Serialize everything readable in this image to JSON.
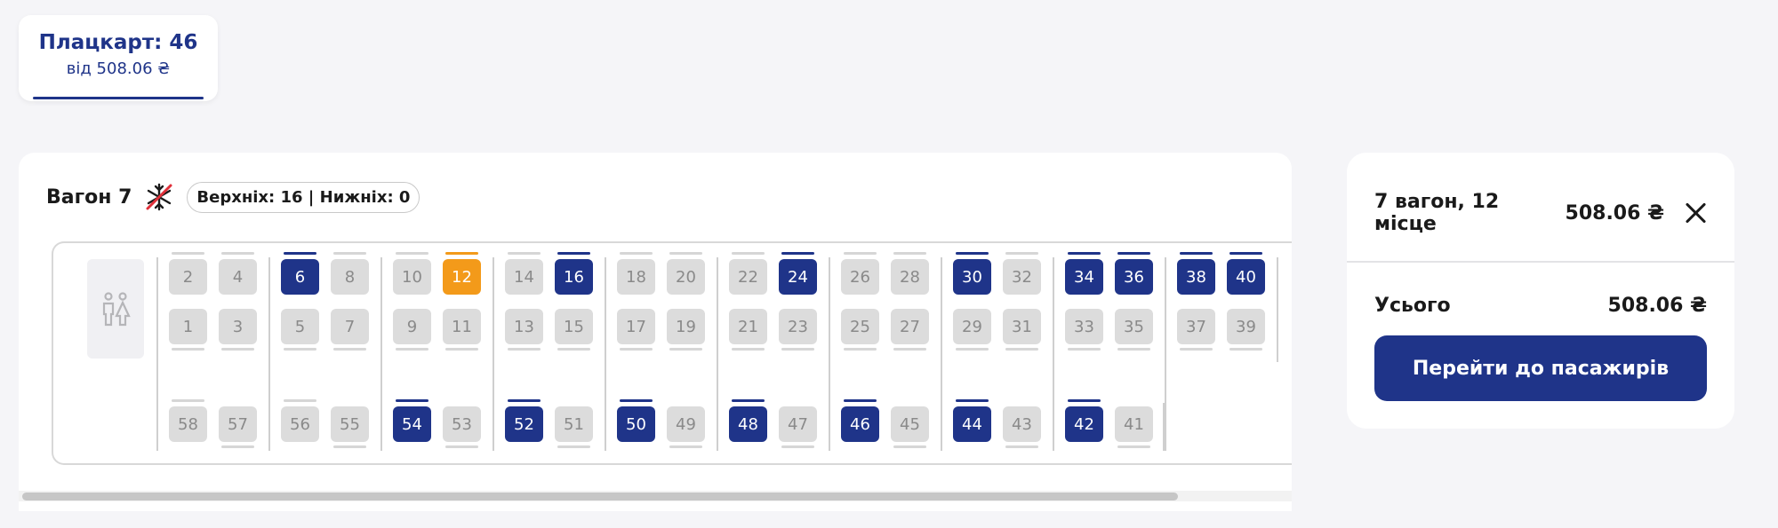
{
  "class_tab": {
    "title": "Плацкарт: 46",
    "price": "від 508.06 ₴"
  },
  "wagon": {
    "title": "Вагон 7",
    "icon": "no-ac-icon",
    "badge": "Верхніх: 16 | Нижніх: 0",
    "wc_icon": "toilet-icon",
    "compartments": [
      {
        "top": [
          [
            "2",
            "free"
          ],
          [
            "4",
            "free"
          ]
        ],
        "bottom": [
          [
            "1",
            "free"
          ],
          [
            "3",
            "free"
          ]
        ],
        "side": [
          [
            "58",
            "free"
          ],
          [
            "57",
            "free"
          ]
        ]
      },
      {
        "top": [
          [
            "6",
            "busy"
          ],
          [
            "8",
            "free"
          ]
        ],
        "bottom": [
          [
            "5",
            "free"
          ],
          [
            "7",
            "free"
          ]
        ],
        "side": [
          [
            "56",
            "free"
          ],
          [
            "55",
            "free"
          ]
        ]
      },
      {
        "top": [
          [
            "10",
            "free"
          ],
          [
            "12",
            "selected"
          ]
        ],
        "bottom": [
          [
            "9",
            "free"
          ],
          [
            "11",
            "free"
          ]
        ],
        "side": [
          [
            "54",
            "busy"
          ],
          [
            "53",
            "free"
          ]
        ]
      },
      {
        "top": [
          [
            "14",
            "free"
          ],
          [
            "16",
            "busy"
          ]
        ],
        "bottom": [
          [
            "13",
            "free"
          ],
          [
            "15",
            "free"
          ]
        ],
        "side": [
          [
            "52",
            "busy"
          ],
          [
            "51",
            "free"
          ]
        ]
      },
      {
        "top": [
          [
            "18",
            "free"
          ],
          [
            "20",
            "free"
          ]
        ],
        "bottom": [
          [
            "17",
            "free"
          ],
          [
            "19",
            "free"
          ]
        ],
        "side": [
          [
            "50",
            "busy"
          ],
          [
            "49",
            "free"
          ]
        ]
      },
      {
        "top": [
          [
            "22",
            "free"
          ],
          [
            "24",
            "busy"
          ]
        ],
        "bottom": [
          [
            "21",
            "free"
          ],
          [
            "23",
            "free"
          ]
        ],
        "side": [
          [
            "48",
            "busy"
          ],
          [
            "47",
            "free"
          ]
        ]
      },
      {
        "top": [
          [
            "26",
            "free"
          ],
          [
            "28",
            "free"
          ]
        ],
        "bottom": [
          [
            "25",
            "free"
          ],
          [
            "27",
            "free"
          ]
        ],
        "side": [
          [
            "46",
            "busy"
          ],
          [
            "45",
            "free"
          ]
        ]
      },
      {
        "top": [
          [
            "30",
            "busy"
          ],
          [
            "32",
            "free"
          ]
        ],
        "bottom": [
          [
            "29",
            "free"
          ],
          [
            "31",
            "free"
          ]
        ],
        "side": [
          [
            "44",
            "busy"
          ],
          [
            "43",
            "free"
          ]
        ]
      },
      {
        "top": [
          [
            "34",
            "busy"
          ],
          [
            "36",
            "busy"
          ]
        ],
        "bottom": [
          [
            "33",
            "free"
          ],
          [
            "35",
            "free"
          ]
        ],
        "side": [
          [
            "42",
            "busy"
          ],
          [
            "41",
            "free"
          ]
        ]
      },
      {
        "top": [
          [
            "38",
            "busy"
          ],
          [
            "40",
            "busy"
          ]
        ],
        "bottom": [
          [
            "37",
            "free"
          ],
          [
            "39",
            "free"
          ]
        ],
        "side": []
      }
    ]
  },
  "summary": {
    "place": "7 вагон, 12 місце",
    "price": "508.06 ₴",
    "total_label": "Усього",
    "total_value": "508.06 ₴",
    "button": "Перейти до пасажирів"
  },
  "colors": {
    "brand": "#1f3489",
    "selected": "#f39a1a",
    "free": "#dcdcdc"
  }
}
